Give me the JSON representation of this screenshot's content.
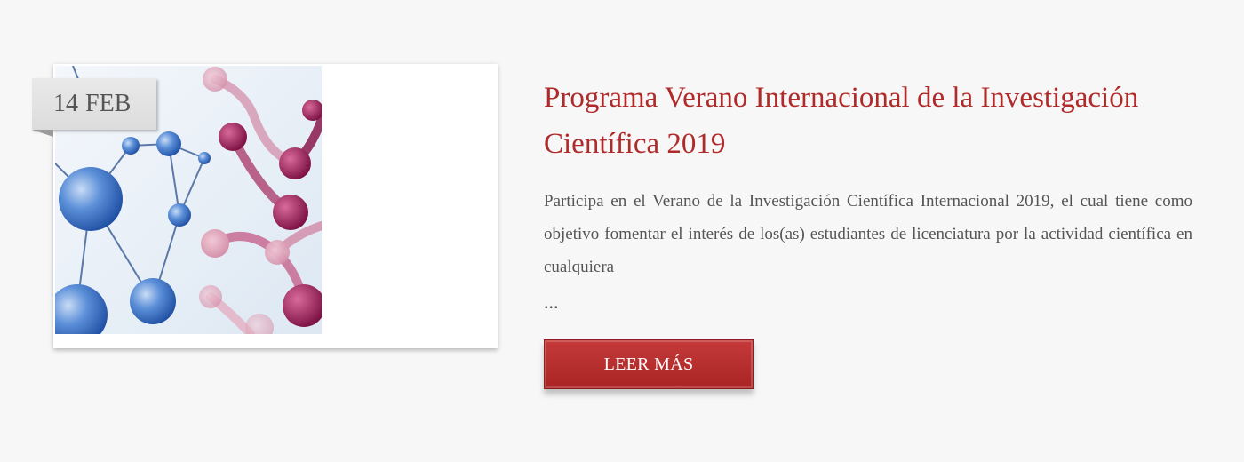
{
  "post": {
    "date": {
      "day": "14",
      "month": "FEB"
    },
    "title": "Programa Verano Internacional de la Investigación Científica 2019",
    "excerpt": "Participa en el Verano de la Investigación Científica Internacional 2019, el cual tiene como objetivo fomentar el interés de los(as) estudiantes de licenciatura por la actividad científica en cualquiera",
    "ellipsis": "...",
    "read_more_label": "LEER MÁS"
  },
  "colors": {
    "title": "#b02a2a",
    "button": "#b83030",
    "molecule_blue": "#3a6fc4",
    "molecule_magenta": "#9a1f5c"
  },
  "image": {
    "icon": "molecule-network-image"
  }
}
